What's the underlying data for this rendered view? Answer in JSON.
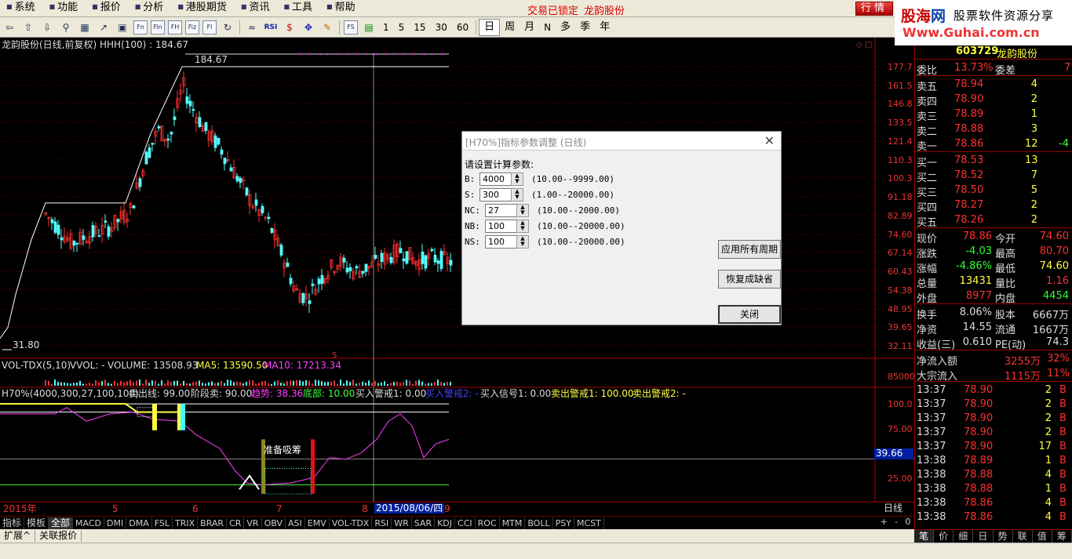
{
  "menubar": {
    "items": [
      "系统",
      "功能",
      "报价",
      "分析",
      "港股期货",
      "资讯",
      "工具",
      "帮助"
    ],
    "trade_status": "交易已锁定",
    "stock_name": "龙韵股份",
    "hangqing_label": "行情"
  },
  "brand": {
    "name_a": "股海",
    "name_b": "网",
    "slogan": "股票软件资源分享",
    "url": "Www.Guhai.com.cn"
  },
  "toolbar": {
    "periods": [
      "1",
      "5",
      "15",
      "30",
      "60",
      "日",
      "周",
      "月",
      "N",
      "多",
      "季",
      "年"
    ],
    "active_period": "日",
    "icon_boxes": [
      "Fn",
      "Fin",
      "FH",
      "Fiz",
      "Fl"
    ],
    "icon_rsi": "RSI",
    "icon_fs": "FS"
  },
  "main_chart": {
    "title": "龙韵股份(日线,前复权) HHH(100) : 184.67",
    "high_label": "184.67",
    "low_label": "31.80",
    "y_ticks": [
      "177.7",
      "161.5",
      "146.8",
      "133.5",
      "121.4",
      "110.3",
      "100.3",
      "91.18",
      "82.89",
      "74.60",
      "67.14",
      "60.43",
      "54.38",
      "48.95",
      "39.65",
      "32.11"
    ],
    "s_marker": "S",
    "chart_data": {
      "type": "candlestick",
      "title": "龙韵股份(日线,前复权) HHH(100) : 184.67",
      "ylim": [
        31.8,
        184.67
      ],
      "annotations": [
        {
          "label": "184.67",
          "kind": "high"
        },
        {
          "label": "31.80",
          "kind": "low"
        }
      ]
    }
  },
  "volume_chart": {
    "title": "VOL-TDX(5,10)",
    "vvol_label": "VVOL: -",
    "volume_label": "VOLUME: 13508.93",
    "ma5_label": "MA5: 13590.50",
    "ma10_label": "MA10: 17213.34",
    "y_tick": "85000",
    "chart_data": {
      "type": "bar",
      "volume": 13508.93,
      "ma5": 13590.5,
      "ma10": 17213.34
    }
  },
  "h70_chart": {
    "title": "H70%(4000,300,27,100,100)",
    "sell_line": "卖出线: 99.00",
    "stage_sell": "阶段卖: 90.00",
    "trend": "趋势: 38.36",
    "bottom": "底部: 10.00",
    "buy_warn1": "买入警戒1: 0.00",
    "buy_warn2": "买入警戒2: -",
    "buy_signal1": "买入信号1: 0.00",
    "sell_warn1": "卖出警戒1: 100.00",
    "sell_warn2": "卖出警戒2: -",
    "annotation": "准备吸筹",
    "y_ticks": [
      "100.0",
      "75.00",
      "25.00"
    ],
    "current_value": "39.66",
    "chart_data": {
      "type": "line",
      "ylim": [
        0,
        100
      ],
      "sell_line": 99.0,
      "stage_sell": 90.0,
      "trend": 38.36,
      "bottom": 10.0
    }
  },
  "x_axis": {
    "labels": [
      "2015年",
      "5",
      "6",
      "7",
      "8",
      "9"
    ],
    "cursor_date": "2015/08/06/四",
    "period_label": "日线",
    "zoom_controls": [
      "+",
      "-",
      "0"
    ]
  },
  "index_tabs": [
    "指标",
    "模板",
    "全部",
    "MACD",
    "DMI",
    "DMA",
    "FSL",
    "TRIX",
    "BRAR",
    "CR",
    "VR",
    "OBV",
    "ASI",
    "EMV",
    "VOL-TDX",
    "RSI",
    "WR",
    "SAR",
    "KDJ",
    "CCI",
    "ROC",
    "MTM",
    "BOLL",
    "PSY",
    "MCST"
  ],
  "index_tabs_active": "全部",
  "ext_bar": [
    "扩展^",
    "关联报价"
  ],
  "right_panel": {
    "code": "603729",
    "name": "龙韵股份",
    "weibi_label": "委比",
    "weibi_value": "13.73%",
    "weicha_label": "委差",
    "weicha_value": "7",
    "sell_levels": [
      {
        "label": "卖五",
        "price": "78.94",
        "vol": "4",
        "chg": ""
      },
      {
        "label": "卖四",
        "price": "78.90",
        "vol": "2",
        "chg": ""
      },
      {
        "label": "卖三",
        "price": "78.89",
        "vol": "1",
        "chg": ""
      },
      {
        "label": "卖二",
        "price": "78.88",
        "vol": "3",
        "chg": ""
      },
      {
        "label": "卖一",
        "price": "78.86",
        "vol": "12",
        "chg": "-4"
      }
    ],
    "buy_levels": [
      {
        "label": "买一",
        "price": "78.53",
        "vol": "13"
      },
      {
        "label": "买二",
        "price": "78.52",
        "vol": "7"
      },
      {
        "label": "买三",
        "price": "78.50",
        "vol": "5"
      },
      {
        "label": "买四",
        "price": "78.27",
        "vol": "2"
      },
      {
        "label": "买五",
        "price": "78.26",
        "vol": "2"
      }
    ],
    "quote": [
      {
        "l1": "现价",
        "v1": "78.86",
        "l2": "今开",
        "v2": "74.60",
        "c1": "#ff3030",
        "c2": "#ff3030"
      },
      {
        "l1": "涨跌",
        "v1": "-4.03",
        "l2": "最高",
        "v2": "80.70",
        "c1": "#30ff30",
        "c2": "#ff3030"
      },
      {
        "l1": "涨幅",
        "v1": "-4.86%",
        "l2": "最低",
        "v2": "74.60",
        "c1": "#30ff30",
        "c2": "#ffff40"
      },
      {
        "l1": "总量",
        "v1": "13431",
        "l2": "量比",
        "v2": "1.16",
        "c1": "#ffff40",
        "c2": "#ff3030"
      },
      {
        "l1": "外盘",
        "v1": "8977",
        "l2": "内盘",
        "v2": "4454",
        "c1": "#ff3030",
        "c2": "#30ff30"
      }
    ],
    "fundamentals": [
      {
        "l1": "换手",
        "v1": "8.06%",
        "l2": "股本",
        "v2": "6667万"
      },
      {
        "l1": "净资",
        "v1": "14.55",
        "l2": "流通",
        "v2": "1667万"
      },
      {
        "l1": "收益(三)",
        "v1": "0.610",
        "l2": "PE(动)",
        "v2": "74.3"
      }
    ],
    "flows": [
      {
        "label": "净流入额",
        "value": "3255万",
        "pct": "32%"
      },
      {
        "label": "大宗流入",
        "value": "1115万",
        "pct": "11%"
      }
    ],
    "ticks": [
      {
        "time": "13:37",
        "price": "78.90",
        "vol": "2",
        "side": "B"
      },
      {
        "time": "13:37",
        "price": "78.90",
        "vol": "2",
        "side": "B"
      },
      {
        "time": "13:37",
        "price": "78.90",
        "vol": "2",
        "side": "B"
      },
      {
        "time": "13:37",
        "price": "78.90",
        "vol": "2",
        "side": "B"
      },
      {
        "time": "13:37",
        "price": "78.90",
        "vol": "17",
        "side": "B"
      },
      {
        "time": "13:38",
        "price": "78.89",
        "vol": "1",
        "side": "B"
      },
      {
        "time": "13:38",
        "price": "78.88",
        "vol": "4",
        "side": "B"
      },
      {
        "time": "13:38",
        "price": "78.88",
        "vol": "1",
        "side": "B"
      },
      {
        "time": "13:38",
        "price": "78.86",
        "vol": "4",
        "side": "B"
      },
      {
        "time": "13:38",
        "price": "78.86",
        "vol": "4",
        "side": "B"
      }
    ],
    "tabs": [
      "笔",
      "价",
      "细",
      "日",
      "势",
      "联",
      "值",
      "筹"
    ]
  },
  "dialog": {
    "title": "[H70%]指标参数调整 (日线)",
    "prompt": "请设置计算参数:",
    "params": [
      {
        "name": "B:",
        "value": "4000",
        "range": "(10.00--9999.00)"
      },
      {
        "name": "S:",
        "value": "300",
        "range": "(1.00--20000.00)"
      },
      {
        "name": "NC:",
        "value": "27",
        "range": "(10.00--2000.00)"
      },
      {
        "name": "NB:",
        "value": "100",
        "range": "(10.00--20000.00)"
      },
      {
        "name": "NS:",
        "value": "100",
        "range": "(10.00--20000.00)"
      }
    ],
    "apply_all": "应用所有周期",
    "restore": "恢复成缺省",
    "close": "关闭"
  }
}
